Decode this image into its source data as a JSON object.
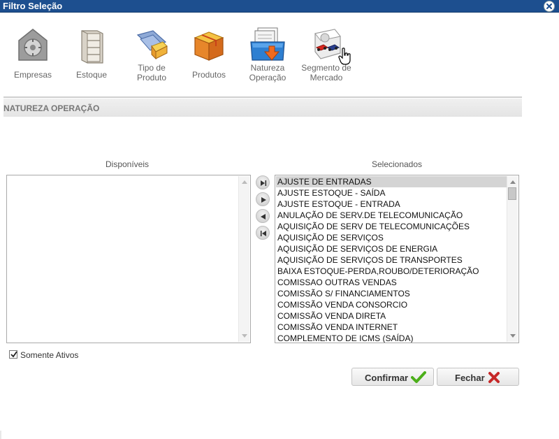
{
  "window": {
    "title": "Filtro Seleção"
  },
  "toolbar": {
    "items": [
      {
        "label": "Empresas",
        "icon": "safe-icon"
      },
      {
        "label": "Estoque",
        "icon": "shelf-icon"
      },
      {
        "label": "Tipo de Produto",
        "icon": "folder-box-icon"
      },
      {
        "label": "Produtos",
        "icon": "package-icon"
      },
      {
        "label": "Natureza Operação",
        "icon": "documents-tray-icon"
      },
      {
        "label": "Segmento de Mercado",
        "icon": "market-segment-icon"
      }
    ]
  },
  "section": {
    "title": "NATUREZA OPERAÇÃO"
  },
  "lists": {
    "available_header": "Disponíveis",
    "selected_header": "Selecionados",
    "available_items": [],
    "selected_items": [
      "AJUSTE DE ENTRADAS",
      "AJUSTE ESTOQUE - SAÍDA",
      "AJUSTE ESTOQUE - ENTRADA",
      "ANULAÇÃO DE SERV.DE TELECOMUNICAÇÃO",
      "AQUISIÇÃO DE SERV DE TELECOMUNICAÇÕES",
      "AQUISIÇÃO DE SERVIÇOS",
      "AQUISIÇÃO DE SERVIÇOS DE ENERGIA",
      "AQUISIÇÃO DE SERVIÇOS DE TRANSPORTES",
      "BAIXA ESTOQUE-PERDA,ROUBO/DETERIORAÇÃO",
      "COMISSAO OUTRAS VENDAS",
      "COMISSÃO S/ FINANCIAMENTOS",
      "COMISSÃO VENDA CONSORCIO",
      "COMISSÃO VENDA DIRETA",
      "COMISSÃO VENDA INTERNET",
      "COMPLEMENTO DE ICMS (SAÍDA)"
    ],
    "highlighted_index": 0
  },
  "options": {
    "somente_ativos_label": "Somente Ativos",
    "somente_ativos_checked": true
  },
  "buttons": {
    "confirm_label": "Confirmar",
    "close_label": "Fechar"
  },
  "colors": {
    "titlebar": "#1d4f8f",
    "confirm_icon": "#4caf1a",
    "close_icon": "#c62828"
  }
}
